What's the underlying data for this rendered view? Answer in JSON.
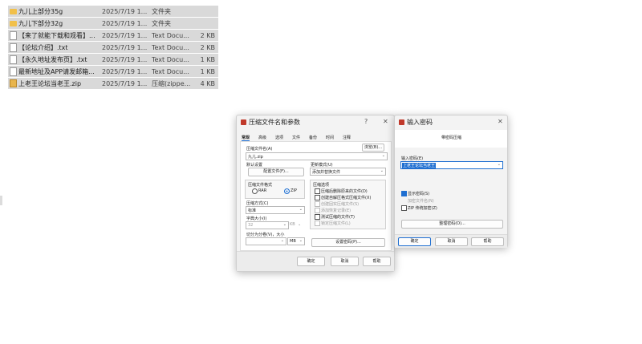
{
  "file_list": {
    "rows": [
      {
        "name": "九儿上部分35g",
        "date": "2025/7/19 1...",
        "type": "文件夹",
        "size": "",
        "icon": "folder-icon"
      },
      {
        "name": "九儿下部分32g",
        "date": "2025/7/19 1...",
        "type": "文件夹",
        "size": "",
        "icon": "folder-icon"
      },
      {
        "name": "【来了就能下载和观看】...",
        "date": "2025/7/19 1...",
        "type": "Text Docu...",
        "size": "2 KB",
        "icon": "text-file-icon"
      },
      {
        "name": "【论坛介绍】.txt",
        "date": "2025/7/19 1...",
        "type": "Text Docu...",
        "size": "2 KB",
        "icon": "text-file-icon"
      },
      {
        "name": "【永久地址发布页】.txt",
        "date": "2025/7/19 1...",
        "type": "Text Docu...",
        "size": "1 KB",
        "icon": "text-file-icon"
      },
      {
        "name": "最新地址及APP请发邮箱...",
        "date": "2025/7/19 1...",
        "type": "Text Docu...",
        "size": "1 KB",
        "icon": "text-file-icon"
      },
      {
        "name": "上老王论坛当老王.zip",
        "date": "2025/7/19 1...",
        "type": "压缩(zippe...",
        "size": "4 KB",
        "icon": "zip-file-icon"
      }
    ]
  },
  "archive_dialog": {
    "title": "压缩文件名和参数",
    "help": "?",
    "close": "✕",
    "tabs": [
      "常规",
      "高级",
      "选项",
      "文件",
      "备份",
      "时间",
      "注释"
    ],
    "archive_name_label": "压缩文件名(A)",
    "browse_button": "浏览(B)...",
    "archive_name_value": "九儿.zip",
    "default_profile_label": "默认设置",
    "profiles_button": "配置文件(F)...",
    "update_mode_label": "更新模式(U)",
    "update_mode_value": "添加并替换文件",
    "format_group_label": "压缩文件格式",
    "format_rar": "RAR",
    "format_zip": "ZIP",
    "method_label": "压缩方式(C)",
    "method_value": "标准",
    "dict_label": "字典大小(I)",
    "dict_value": "32",
    "dict_unit": "KB",
    "split_label": "切分为分卷(V)，大小",
    "split_unit": "MB",
    "options_group_label": "压缩选项",
    "options": [
      {
        "label": "压缩后删除原来的文件(D)",
        "checked": false,
        "dim": false
      },
      {
        "label": "创建自解压格式压缩文件(X)",
        "checked": false,
        "dim": false
      },
      {
        "label": "创建固实压缩文件(S)",
        "checked": false,
        "dim": true
      },
      {
        "label": "添加恢复记录(E)",
        "checked": false,
        "dim": true
      },
      {
        "label": "测试压缩的文件(T)",
        "checked": false,
        "dim": false
      },
      {
        "label": "锁定压缩文件(L)",
        "checked": false,
        "dim": true
      }
    ],
    "set_password_button": "设置密码(P)...",
    "ok": "确定",
    "cancel": "取消",
    "help_button": "帮助"
  },
  "password_dialog": {
    "title": "输入密码",
    "close": "✕",
    "subtitle": "带密码压缩",
    "password_label": "输入密码(E)",
    "password_value": "上老王论坛当老王",
    "show_password": "显示密码(S)",
    "encrypt_filenames": "加密文件名(N)",
    "zip_legacy": "ZIP 传统加密(Z)",
    "organize_button": "整理密码(O)...",
    "ok": "确定",
    "cancel": "取消",
    "help_button": "帮助"
  },
  "colors": {
    "accent": "#1f6fd1",
    "folder": "#f1c04a",
    "selection": "#d9d9d9"
  }
}
